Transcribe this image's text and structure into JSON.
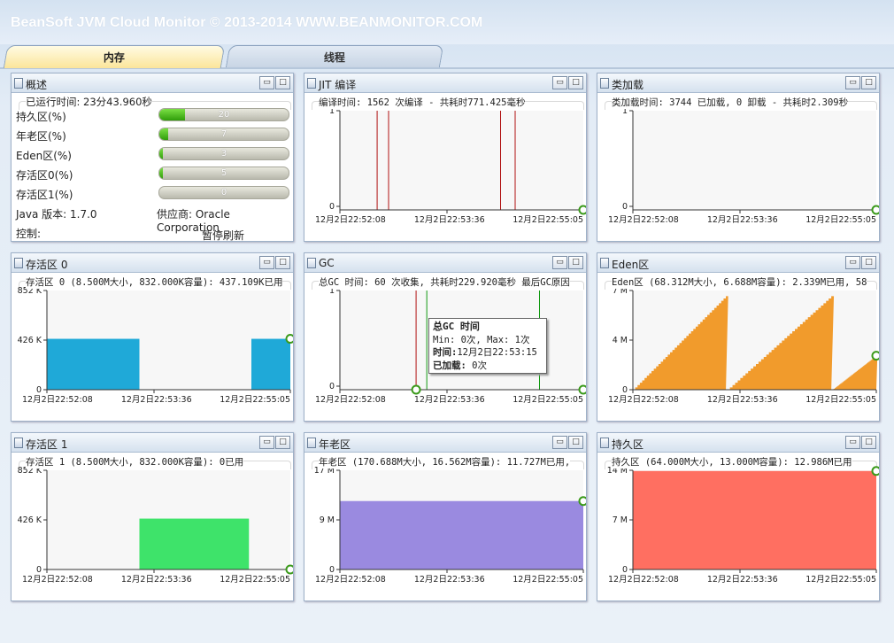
{
  "app": {
    "title": "BeanSoft JVM Cloud Monitor © 2013-2014 WWW.BEANMONITOR.COM"
  },
  "tabs": [
    {
      "label": "内存",
      "active": true
    },
    {
      "label": "线程",
      "active": false
    }
  ],
  "colors": {
    "survivor0": "#1fa9d8",
    "survivor1": "#3ee36a",
    "old_gen": "#9a8ae0",
    "perm_gen": "#ff6f61",
    "eden": "#f19b2c",
    "jit_line": "#b01010",
    "gc_line": "#119911",
    "marker": "#3a9a1a"
  },
  "window_buttons": {
    "minimize": "▭",
    "maximize": "□"
  },
  "overview": {
    "title": "概述",
    "uptime": "已运行时间: 23分43.960秒",
    "bars": [
      {
        "label": "持久区(%)",
        "value": 20,
        "display": "20"
      },
      {
        "label": "年老区(%)",
        "value": 7,
        "display": "7"
      },
      {
        "label": "Eden区(%)",
        "value": 3,
        "display": "3"
      },
      {
        "label": "存活区0(%)",
        "value": 5,
        "display": "5"
      },
      {
        "label": "存活区1(%)",
        "value": 0,
        "display": "0"
      }
    ],
    "java_version": "Java 版本: 1.7.0",
    "vendor": "供应商: Oracle Corporation",
    "control_label": "控制:",
    "pause_button": "暂停刷新"
  },
  "panels": {
    "jit": {
      "title": "JIT 编译",
      "subtitle": "编译时间: 1562 次编译 - 共耗时771.425毫秒"
    },
    "classload": {
      "title": "类加载",
      "subtitle": "类加载时间: 3744 已加载, 0 卸载 - 共耗时2.309秒"
    },
    "survivor0": {
      "title": "存活区 0",
      "subtitle": "存活区 0 (8.500M大小, 832.000K容量): 437.109K已用"
    },
    "gc": {
      "title": "GC",
      "subtitle": "总GC 时间: 60 次收集, 共耗时229.920毫秒 最后GC原因"
    },
    "eden": {
      "title": "Eden区",
      "subtitle": "Eden区 (68.312M大小, 6.688M容量): 2.339M已用, 58"
    },
    "survivor1": {
      "title": "存活区 1",
      "subtitle": "存活区 1 (8.500M大小, 832.000K容量): 0已用"
    },
    "oldgen": {
      "title": "年老区",
      "subtitle": "年老区 (170.688M大小, 16.562M容量): 11.727M已用,"
    },
    "permgen": {
      "title": "持久区",
      "subtitle": "持久区 (64.000M大小, 13.000M容量): 12.986M已用"
    }
  },
  "gc_tooltip": {
    "title": "总GC 时间",
    "minmax": "Min: 0次, Max: 1次",
    "time_label": "时间:",
    "time_value": "12月2日22:53:15",
    "loaded_label": "已加载:",
    "loaded_value": "0次"
  },
  "chart_data": [
    {
      "id": "jit",
      "type": "line",
      "x_ticks": [
        "12月2日22:52:08",
        "12月2日22:53:36",
        "12月2日22:55:05"
      ],
      "y_ticks": [
        "1",
        "0"
      ],
      "ylim": [
        0,
        1
      ],
      "spikes_x": [
        0.153,
        0.2,
        0.66,
        0.72
      ]
    },
    {
      "id": "classload",
      "type": "line",
      "x_ticks": [
        "12月2日22:52:08",
        "12月2日22:53:36",
        "12月2日22:55:05"
      ],
      "y_ticks": [
        "1",
        "0"
      ],
      "ylim": [
        0,
        1
      ],
      "spikes_x": []
    },
    {
      "id": "gc",
      "type": "line",
      "x_ticks": [
        "12月2日22:52:08",
        "12月2日22:53:36",
        "12月2日22:55:05"
      ],
      "y_ticks": [
        "1",
        "0"
      ],
      "ylim": [
        0,
        1
      ],
      "spikes_x": [
        0.313,
        0.357,
        0.82
      ]
    },
    {
      "id": "survivor0",
      "type": "area",
      "x_ticks": [
        "12月2日22:52:08",
        "12月2日22:53:36",
        "12月2日22:55:05"
      ],
      "y_ticks": [
        "852 K",
        "426 K",
        "0"
      ],
      "ylim": [
        0,
        852
      ],
      "segments": [
        {
          "from": 0.0,
          "to": 0.38,
          "value": 437
        },
        {
          "from": 0.84,
          "to": 1.0,
          "value": 437
        }
      ]
    },
    {
      "id": "eden",
      "type": "area",
      "x_ticks": [
        "12月2日22:52:08",
        "12月2日22:53:36",
        "12月2日22:55:05"
      ],
      "y_ticks": [
        "7 M",
        "4 M",
        "0"
      ],
      "ylim": [
        0,
        7
      ],
      "sawtooth": [
        {
          "from": 0.0,
          "to": 0.382,
          "start": 0.0,
          "end": 6.6
        },
        {
          "from": 0.388,
          "to": 0.815,
          "start": 0.0,
          "end": 6.6
        },
        {
          "from": 0.82,
          "to": 1.0,
          "start": 0.0,
          "end": 2.4
        }
      ]
    },
    {
      "id": "survivor1",
      "type": "area",
      "x_ticks": [
        "12月2日22:52:08",
        "12月2日22:53:36",
        "12月2日22:55:05"
      ],
      "y_ticks": [
        "852 K",
        "426 K",
        "0"
      ],
      "ylim": [
        0,
        852
      ],
      "segments": [
        {
          "from": 0.38,
          "to": 0.83,
          "value": 437
        }
      ]
    },
    {
      "id": "oldgen",
      "type": "area",
      "x_ticks": [
        "12月2日22:52:08",
        "12月2日22:53:36",
        "12月2日22:55:05"
      ],
      "y_ticks": [
        "17 M",
        "9 M",
        "0"
      ],
      "ylim": [
        0,
        17
      ],
      "segments": [
        {
          "from": 0.0,
          "to": 1.0,
          "value": 11.727
        }
      ]
    },
    {
      "id": "permgen",
      "type": "area",
      "x_ticks": [
        "12月2日22:52:08",
        "12月2日22:53:36",
        "12月2日22:55:05"
      ],
      "y_ticks": [
        "14 M",
        "7 M",
        "0"
      ],
      "ylim": [
        0,
        14
      ],
      "segments": [
        {
          "from": 0.0,
          "to": 1.0,
          "value": 13.9
        }
      ]
    }
  ]
}
